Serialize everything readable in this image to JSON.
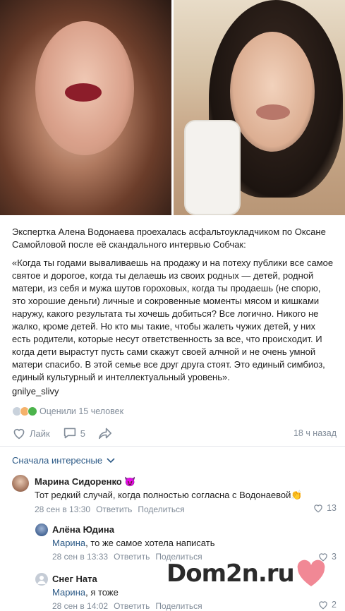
{
  "post": {
    "intro": "Экспертка Алена Водонаева проехалась асфальтоукладчиком по Оксане Самойловой после её скандального интервью Собчак:",
    "quote": "«Когда ты годами вываливаешь на продажу и на потеху публики все самое святое и дорогое, когда ты делаешь из своих родных — детей, родной матери, из себя и мужа шутов гороховых, когда ты продаешь (не спорю, это хорошие деньги) личные и сокровенные моменты мясом и кишками наружу, какого результата ты хочешь добиться? Все логично. Никого не жалко, кроме детей. Но кто мы такие, чтобы жалеть чужих детей, у них есть родители, которые несут ответственность за все, что происходит. И когда дети вырастут пусть сами скажут своей алчной и не очень умной матери спасибо. В этой семье все друг друга стоят. Это единый симбиоз, единый культурный и интеллектуальный уровень».",
    "signature": "gnilye_slivy",
    "rated_text": "Оценили 15 человек"
  },
  "actions": {
    "like_label": "Лайк",
    "comments_count": "5",
    "time_ago": "18 ч назад"
  },
  "comments_sort": "Сначала интересные",
  "comments": [
    {
      "name": "Марина Сидоренко",
      "name_emoji": "😈",
      "text": "Тот редкий случай, когда полностью согласна с Водонаевой",
      "text_emoji": "👏",
      "date": "28 сен в 13:30",
      "reply_label": "Ответить",
      "share_label": "Поделиться",
      "likes": "13"
    },
    {
      "name": "Алёна Юдина",
      "reply_to": "Марина",
      "text": ", то же самое хотела написать",
      "date": "28 сен в 13:33",
      "reply_label": "Ответить",
      "share_label": "Поделиться",
      "likes": "3"
    },
    {
      "name": "Снег Ната",
      "reply_to": "Марина",
      "text": ", я тоже",
      "date": "28 сен в 14:02",
      "reply_label": "Ответить",
      "share_label": "Поделиться",
      "likes": "2"
    }
  ],
  "watermark": "Dom2n.ru",
  "colors": {
    "link": "#2a5885",
    "meta": "#818c99",
    "heart": "#f07b8a"
  }
}
